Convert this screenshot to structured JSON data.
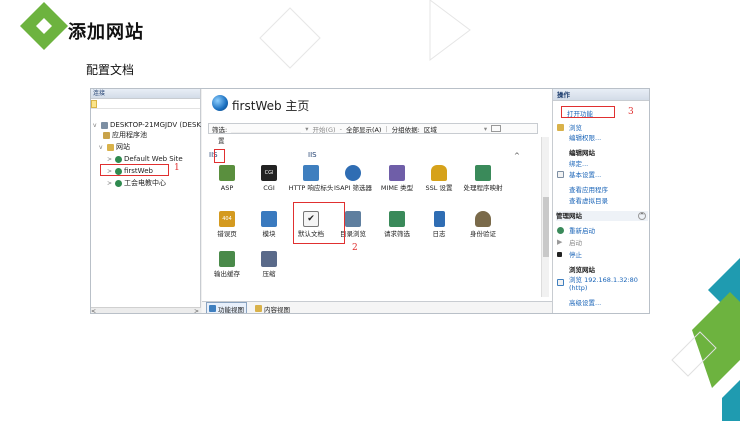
{
  "slide": {
    "title": "添加网站",
    "subtitle": "配置文档"
  },
  "connections": {
    "header": "连接",
    "tree": [
      {
        "label": "DESKTOP-21MGJDV (DESK",
        "icon": "server-icon"
      },
      {
        "label": "应用程序池",
        "icon": "app-pool-icon"
      },
      {
        "label": "网站",
        "icon": "folder-icon"
      },
      {
        "label": "Default Web Site",
        "icon": "globe-icon"
      },
      {
        "label": "firstWeb",
        "icon": "globe-icon"
      },
      {
        "label": "工会电教中心",
        "icon": "globe-icon"
      }
    ]
  },
  "center": {
    "title": "firstWeb 主页",
    "filter_label": "筛选:",
    "go_label": "开始(G)",
    "show_all_label": "全部显示(A)",
    "group_label": "分组依据:",
    "group_value": "区域",
    "section_strip": "置",
    "section_iis": "IIS",
    "features": [
      {
        "label": "ASP",
        "icon": "asp-icon",
        "color": "#5a8f3e"
      },
      {
        "label": "CGI",
        "icon": "cgi-icon",
        "color": "#222222"
      },
      {
        "label": "HTTP 响应标头",
        "icon": "http-headers-icon",
        "color": "#3f7fbf"
      },
      {
        "label": "ISAPI 筛选器",
        "icon": "isapi-filters-icon",
        "color": "#2f6db3"
      },
      {
        "label": "MIME 类型",
        "icon": "mime-types-icon",
        "color": "#6f5ea8"
      },
      {
        "label": "SSL 设置",
        "icon": "ssl-lock-icon",
        "color": "#d6a21a"
      },
      {
        "label": "处理程序映射",
        "icon": "handler-mappings-icon",
        "color": "#3a8a5a"
      },
      {
        "label": "错误页",
        "icon": "error-pages-icon",
        "color": "#d49a1f"
      },
      {
        "label": "模块",
        "icon": "modules-icon",
        "color": "#3a7abf"
      },
      {
        "label": "默认文档",
        "icon": "default-document-icon",
        "color": "#555555"
      },
      {
        "label": "目录浏览",
        "icon": "directory-browsing-icon",
        "color": "#5f7f9f"
      },
      {
        "label": "请求筛选",
        "icon": "request-filtering-icon",
        "color": "#3a8a5a"
      },
      {
        "label": "日志",
        "icon": "logging-icon",
        "color": "#2f6db3"
      },
      {
        "label": "身份验证",
        "icon": "authentication-icon",
        "color": "#7a6a4a"
      },
      {
        "label": "输出缓存",
        "icon": "output-caching-icon",
        "color": "#4a8a4a"
      },
      {
        "label": "压缩",
        "icon": "compression-icon",
        "color": "#5a6a8a"
      }
    ],
    "tab_features": "功能视图",
    "tab_content": "内容视图"
  },
  "actions": {
    "header": "操作",
    "open_feature": "打开功能",
    "explore": "浏览",
    "edit_permissions": "编辑权限...",
    "edit_site_title": "编辑网站",
    "bindings": "绑定...",
    "basic_settings": "基本设置...",
    "view_applications": "查看应用程序",
    "view_virtual_dirs": "查看虚拟目录",
    "manage_site_title": "管理网站",
    "restart": "重新启动",
    "start": "启动",
    "stop": "停止",
    "browse_site_title": "浏览网站",
    "browse_link": "浏览 192.168.1.32:80 (http)",
    "advanced_settings": "高级设置..."
  },
  "annotations": {
    "n1": "1",
    "n2": "2",
    "n3": "3",
    "color": "#e03030"
  },
  "colors": {
    "deco_green": "#6db33f",
    "deco_teal": "#1f9bb0"
  }
}
